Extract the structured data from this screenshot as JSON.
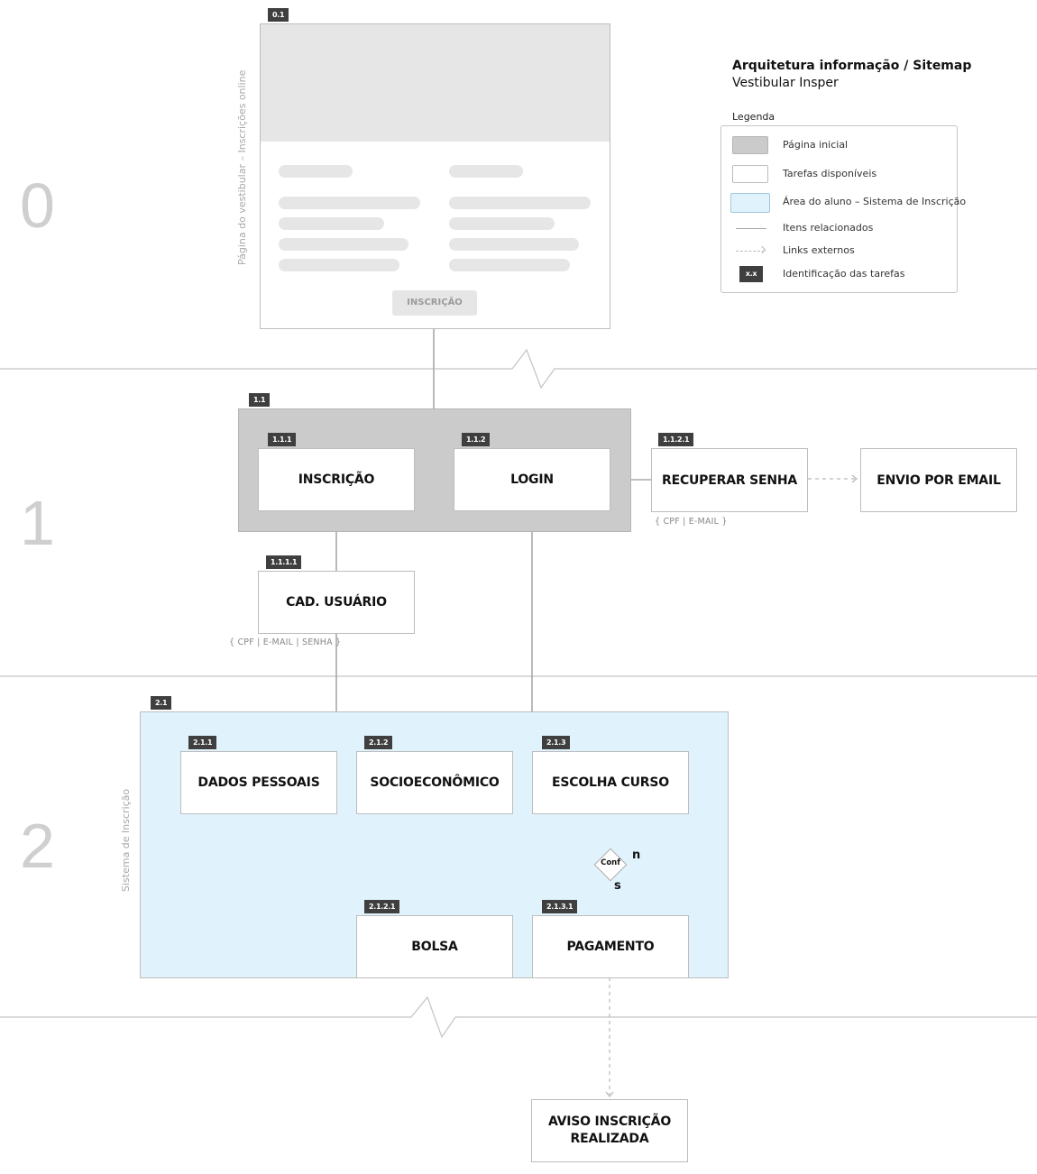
{
  "header": {
    "title": "Arquitetura informação / Sitemap",
    "subtitle": "Vestibular Insper"
  },
  "legend": {
    "title": "Legenda",
    "items": [
      {
        "label": "Página inicial",
        "swatch": "#cbcbcb"
      },
      {
        "label": "Tarefas disponíveis",
        "swatch": "#ffffff"
      },
      {
        "label": "Área do aluno – Sistema de Inscrição",
        "swatch": "#e0f3fc"
      },
      {
        "label": "Itens relacionados"
      },
      {
        "label": "Links externos"
      },
      {
        "label": "Identificação das tarefas",
        "tag": "x.x"
      }
    ]
  },
  "levels": [
    "0",
    "1",
    "2"
  ],
  "homepage": {
    "tag": "0.1",
    "side_label": "Página do vestibular – Inscrições online",
    "button": "INSCRIÇÃO"
  },
  "groups": {
    "g11": {
      "tag": "1.1"
    },
    "g21": {
      "tag": "2.1",
      "side_label": "Sistema de Inscrição"
    }
  },
  "nodes": {
    "n111": {
      "tag": "1.1.1",
      "label": "INSCRIÇÃO"
    },
    "n112": {
      "tag": "1.1.2",
      "label": "LOGIN"
    },
    "n1121": {
      "tag": "1.1.2.1",
      "label": "RECUPERAR SENHA",
      "note": "{ CPF | E-MAIL }"
    },
    "email": {
      "label": "ENVIO POR EMAIL"
    },
    "n1111": {
      "tag": "1.1.1.1",
      "label": "CAD. USUÁRIO",
      "note": "{ CPF | E-MAIL | SENHA }"
    },
    "n211": {
      "tag": "2.1.1",
      "label": "DADOS PESSOAIS"
    },
    "n212": {
      "tag": "2.1.2",
      "label": "SOCIOECONÔMICO"
    },
    "n213": {
      "tag": "2.1.3",
      "label": "ESCOLHA CURSO"
    },
    "n2121": {
      "tag": "2.1.2.1",
      "label": "BOLSA"
    },
    "n2131": {
      "tag": "2.1.3.1",
      "label": "PAGAMENTO"
    },
    "aviso": {
      "label_line1": "AVISO INSCRIÇÃO",
      "label_line2": "REALIZADA"
    }
  },
  "decision": {
    "label": "Conf",
    "yes": "s",
    "no": "n"
  }
}
